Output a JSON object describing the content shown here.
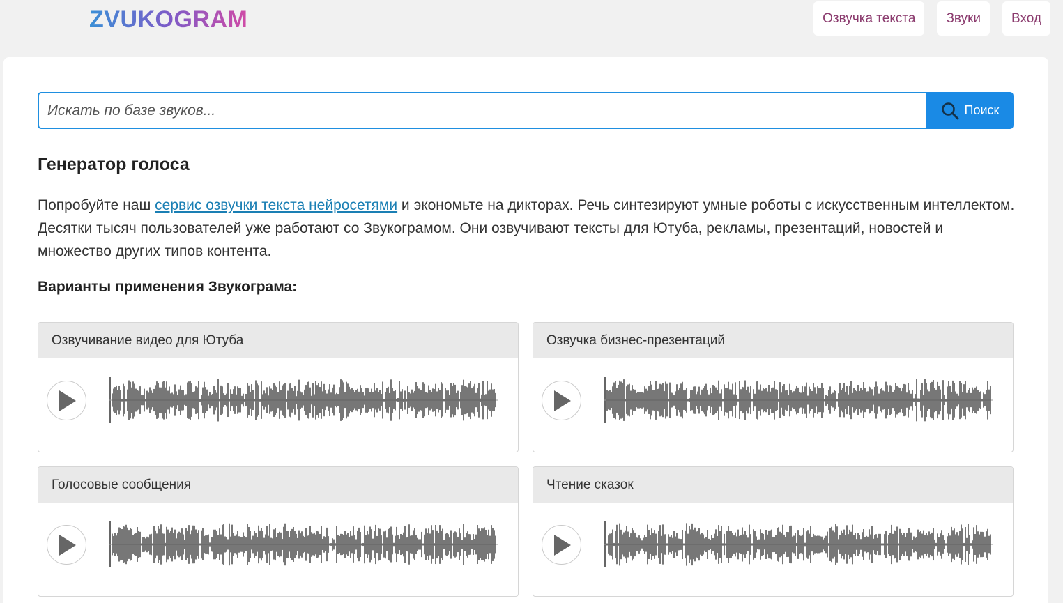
{
  "logo": {
    "text": "ZVUKOGRAM"
  },
  "nav": [
    {
      "label": "Озвучка текста"
    },
    {
      "label": "Звуки"
    },
    {
      "label": "Вход"
    }
  ],
  "search": {
    "placeholder": "Искать по базе звуков...",
    "button_label": "Поиск",
    "icon": "search-icon"
  },
  "heading": "Генератор голоса",
  "intro": {
    "before": "Попробуйте наш ",
    "link": "сервис озвучки текста нейросетями",
    "after": " и экономьте на дикторах. Речь синтезируют умные роботы с искусственным интеллектом. Десятки тысяч пользователей уже работают со Звукограмом. Они озвучивают тексты для Ютуба, рекламы, презентаций, новостей и множество других типов контента."
  },
  "use_cases_title": "Варианты применения Звукограма:",
  "samples": [
    {
      "title": "Озвучивание видео для Ютуба",
      "icon": "play-icon"
    },
    {
      "title": "Озвучка бизнес-презентаций",
      "icon": "play-icon"
    },
    {
      "title": "Голосовые сообщения",
      "icon": "play-icon"
    },
    {
      "title": "Чтение сказок",
      "icon": "play-icon"
    }
  ],
  "colors": {
    "accent": "#1a8ae5",
    "nav_text": "#8b3b6e",
    "link": "#1a7fb4",
    "waveform": "#555555"
  }
}
